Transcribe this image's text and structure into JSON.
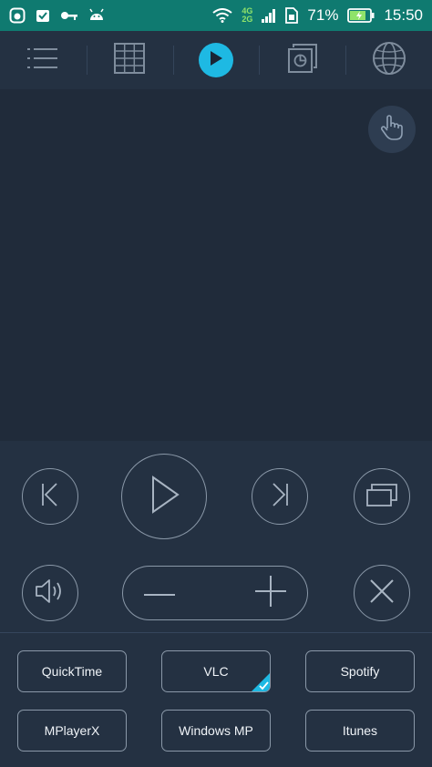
{
  "status_bar": {
    "battery_percent": "71%",
    "time": "15:50",
    "network_top": "4G",
    "network_bottom": "2G",
    "bg_color": "#0f7a70"
  },
  "toolbar": {
    "tabs": [
      {
        "name": "menu-icon",
        "selected": false
      },
      {
        "name": "grid-icon",
        "selected": false
      },
      {
        "name": "play-icon",
        "selected": true
      },
      {
        "name": "presentation-icon",
        "selected": false
      },
      {
        "name": "globe-icon",
        "selected": false
      }
    ],
    "accent_color": "#1eb9e3"
  },
  "touchpad": {
    "gesture_icon": "hand-pointer-icon"
  },
  "controls": {
    "buttons": [
      "previous-icon",
      "play-icon",
      "next-icon",
      "window-switch-icon",
      "speaker-icon",
      "volume-down-icon",
      "volume-up-icon",
      "close-icon"
    ]
  },
  "players": {
    "items": [
      {
        "label": "QuickTime",
        "selected": false
      },
      {
        "label": "VLC",
        "selected": true
      },
      {
        "label": "Spotify",
        "selected": false
      },
      {
        "label": "MPlayerX",
        "selected": false
      },
      {
        "label": "Windows MP",
        "selected": false
      },
      {
        "label": "Itunes",
        "selected": false
      }
    ],
    "check_color": "#1eb9e3"
  }
}
